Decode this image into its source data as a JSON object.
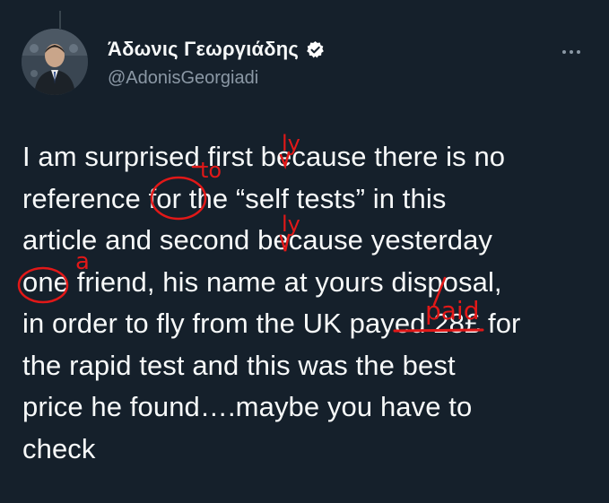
{
  "tweet": {
    "author": {
      "display_name": "Άδωνις Γεωργιάδης",
      "handle": "@AdonisGeorgiadi",
      "verified": true,
      "avatar_icon": "avatar-photo"
    },
    "more_icon": "more-horizontal-icon",
    "text_lines": [
      "I am surprised first because there is no",
      "reference for the “self tests” in this",
      "article and second because yesterday",
      "one friend, his name at yours disposal,",
      "in order to fly from the UK payed 28£ for",
      "the rapid test and this was the best",
      "price he found….maybe you have to",
      "check"
    ]
  },
  "annotations": {
    "color": "#e11818",
    "insert_ly_1": "ly",
    "insert_to": "to",
    "insert_ly_2": "ly",
    "insert_a": "a",
    "replace_paid": "paid"
  },
  "colors": {
    "background": "#15202b",
    "text": "#f7f9f9",
    "secondary": "#8b98a5",
    "verified": "#ffffff"
  }
}
